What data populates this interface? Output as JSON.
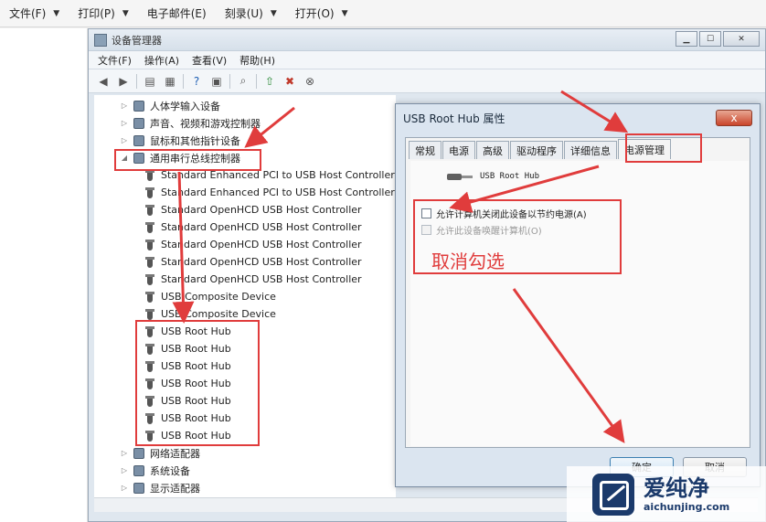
{
  "outer_menu": [
    {
      "label": "文件(F)"
    },
    {
      "label": "打印(P)"
    },
    {
      "label": "电子邮件(E)"
    },
    {
      "label": "刻录(U)"
    },
    {
      "label": "打开(O)"
    }
  ],
  "device_manager": {
    "title": "设备管理器",
    "menus": [
      "文件(F)",
      "操作(A)",
      "查看(V)",
      "帮助(H)"
    ],
    "tree": [
      {
        "label": "人体学输入设备",
        "indent": 1,
        "expand": "▷"
      },
      {
        "label": "声音、视频和游戏控制器",
        "indent": 1,
        "expand": "▷"
      },
      {
        "label": "鼠标和其他指针设备",
        "indent": 1,
        "expand": "▷"
      },
      {
        "label": "通用串行总线控制器",
        "indent": 1,
        "expand": "◢"
      },
      {
        "label": "Standard Enhanced PCI to USB Host Controller",
        "indent": 2
      },
      {
        "label": "Standard Enhanced PCI to USB Host Controller",
        "indent": 2
      },
      {
        "label": "Standard OpenHCD USB Host Controller",
        "indent": 2
      },
      {
        "label": "Standard OpenHCD USB Host Controller",
        "indent": 2
      },
      {
        "label": "Standard OpenHCD USB Host Controller",
        "indent": 2
      },
      {
        "label": "Standard OpenHCD USB Host Controller",
        "indent": 2
      },
      {
        "label": "Standard OpenHCD USB Host Controller",
        "indent": 2
      },
      {
        "label": "USB Composite Device",
        "indent": 2
      },
      {
        "label": "USB Composite Device",
        "indent": 2
      },
      {
        "label": "USB Root Hub",
        "indent": 2
      },
      {
        "label": "USB Root Hub",
        "indent": 2
      },
      {
        "label": "USB Root Hub",
        "indent": 2
      },
      {
        "label": "USB Root Hub",
        "indent": 2
      },
      {
        "label": "USB Root Hub",
        "indent": 2
      },
      {
        "label": "USB Root Hub",
        "indent": 2
      },
      {
        "label": "USB Root Hub",
        "indent": 2
      },
      {
        "label": "网络适配器",
        "indent": 1,
        "expand": "▷"
      },
      {
        "label": "系统设备",
        "indent": 1,
        "expand": "▷"
      },
      {
        "label": "显示适配器",
        "indent": 1,
        "expand": "▷"
      }
    ]
  },
  "properties": {
    "title": "USB Root Hub 属性",
    "close": "x",
    "tabs": [
      "常规",
      "电源",
      "高级",
      "驱动程序",
      "详细信息",
      "电源管理"
    ],
    "device_name": "USB Root Hub",
    "options": [
      {
        "label": "允许计算机关闭此设备以节约电源(A)",
        "enabled": true,
        "checked": false
      },
      {
        "label": "允许此设备唤醒计算机(O)",
        "enabled": false,
        "checked": false
      }
    ],
    "ok_label": "确定",
    "cancel_label": "取消"
  },
  "annotation": {
    "uncheck_text": "取消勾选",
    "color": "#e03c3c"
  },
  "watermark": {
    "brand": "爱纯净",
    "site": "aichunjing.com"
  }
}
